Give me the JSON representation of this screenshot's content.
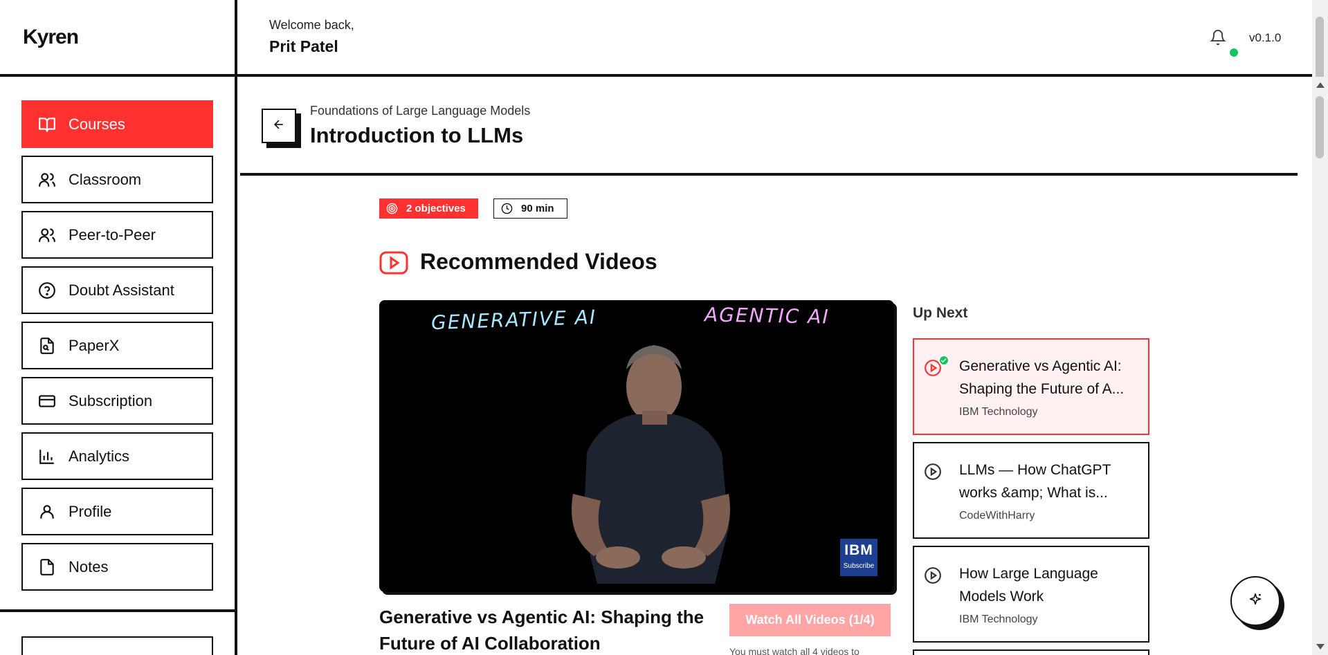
{
  "app": {
    "logo": "Kyren",
    "version": "v0.1.0"
  },
  "user": {
    "greeting": "Welcome back,",
    "name": "Prit Patel"
  },
  "sidebar": {
    "items": [
      {
        "label": "Courses",
        "icon": "book-open-icon",
        "active": true
      },
      {
        "label": "Classroom",
        "icon": "users-icon"
      },
      {
        "label": "Peer-to-Peer",
        "icon": "users-icon"
      },
      {
        "label": "Doubt Assistant",
        "icon": "help-circle-icon"
      },
      {
        "label": "PaperX",
        "icon": "file-search-icon"
      },
      {
        "label": "Subscription",
        "icon": "credit-card-icon"
      },
      {
        "label": "Analytics",
        "icon": "bar-chart-icon"
      },
      {
        "label": "Profile",
        "icon": "user-icon"
      },
      {
        "label": "Notes",
        "icon": "file-icon"
      }
    ]
  },
  "page": {
    "breadcrumb": "Foundations of Large Language Models",
    "title": "Introduction to LLMs",
    "objectives_badge": "2 objectives",
    "duration_badge": "90 min",
    "section_title": "Recommended Videos"
  },
  "video": {
    "overlay_left": "GENERATIVE AI",
    "overlay_right": "AGENTIC AI",
    "brand": "IBM",
    "brand_sub": "Subscribe",
    "title": "Generative vs Agentic AI: Shaping the Future of AI Collaboration",
    "watch_all_label": "Watch All Videos (1/4)",
    "watch_note": "You must watch all 4 videos to"
  },
  "up_next": {
    "label": "Up Next",
    "items": [
      {
        "title": "Generative vs Agentic AI: Shaping the Future of A...",
        "channel": "IBM Technology",
        "active": true,
        "completed": true
      },
      {
        "title": "LLMs — How ChatGPT works &amp; What is...",
        "channel": "CodeWithHarry"
      },
      {
        "title": "How Large Language Models Work",
        "channel": "IBM Technology"
      }
    ]
  },
  "colors": {
    "accent": "#ff3131",
    "success": "#16c45a",
    "disabled_accent": "#ffa5a5",
    "active_card_bg": "#fff1f1"
  }
}
